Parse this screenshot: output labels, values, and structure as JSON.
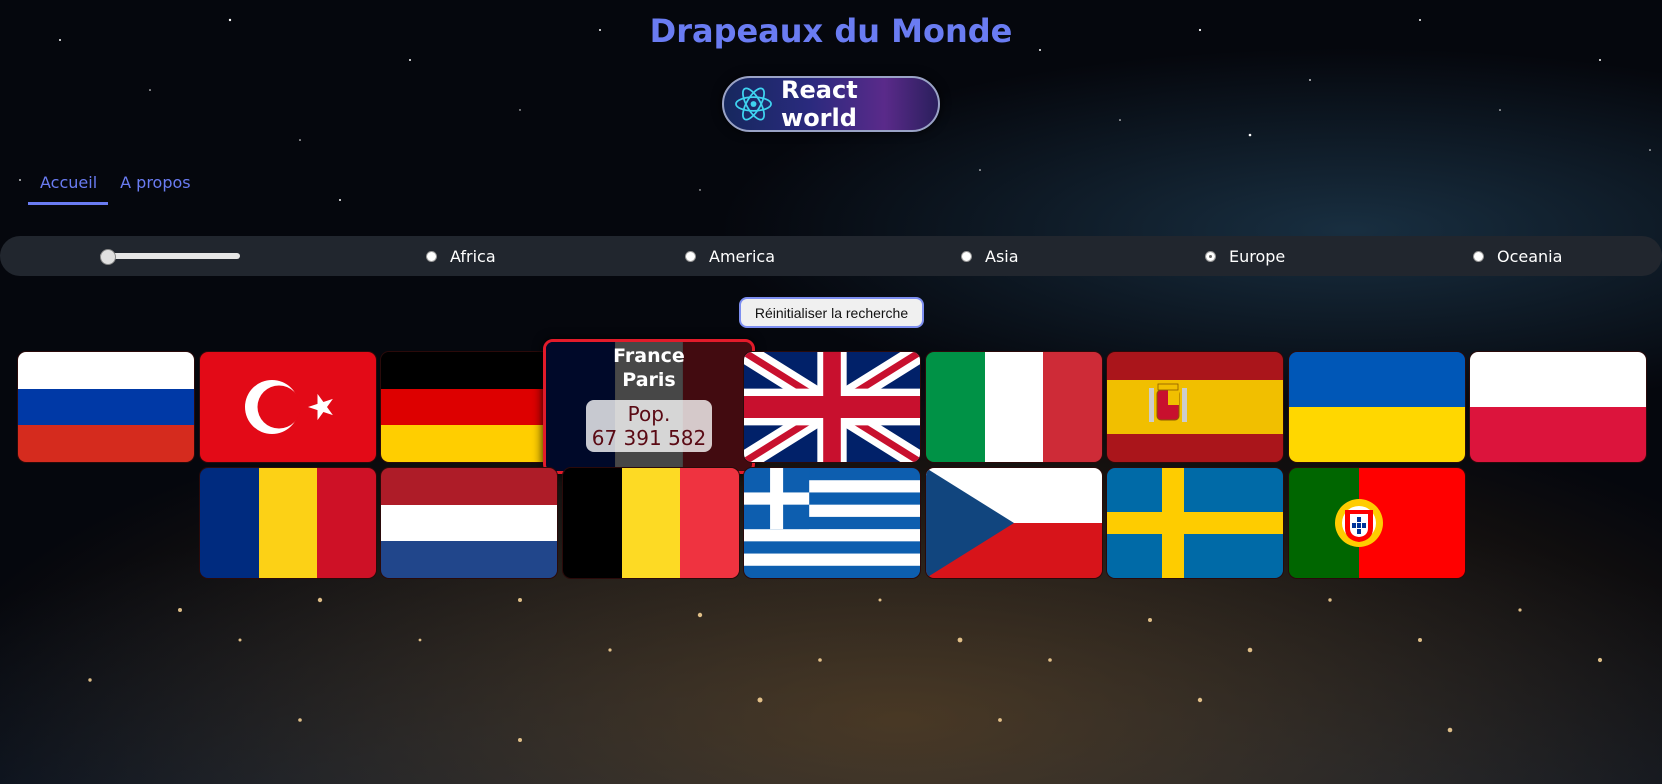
{
  "page": {
    "title": "Drapeaux du Monde"
  },
  "logo": {
    "text": "React world"
  },
  "nav": {
    "items": [
      "Accueil",
      "A propos"
    ],
    "active": "Accueil"
  },
  "filters": {
    "range": {
      "value": 1
    },
    "regions": [
      "Africa",
      "America",
      "Asia",
      "Europe",
      "Oceania"
    ],
    "selected_region": "Europe"
  },
  "reset_button": "Réinitialiser la recherche",
  "hovered_card": {
    "name": "France",
    "capital": "Paris",
    "population_label": "Pop.",
    "population": "67 391 582"
  },
  "flags": [
    "russia",
    "turkey",
    "germany",
    "france",
    "united-kingdom",
    "italy",
    "spain",
    "ukraine",
    "poland",
    "romania",
    "netherlands",
    "belgium",
    "greece",
    "czechia",
    "sweden",
    "portugal"
  ],
  "colors": {
    "accent": "#6a7cf2",
    "hover_border": "#e21b2a",
    "filterbar": "#21262e"
  }
}
